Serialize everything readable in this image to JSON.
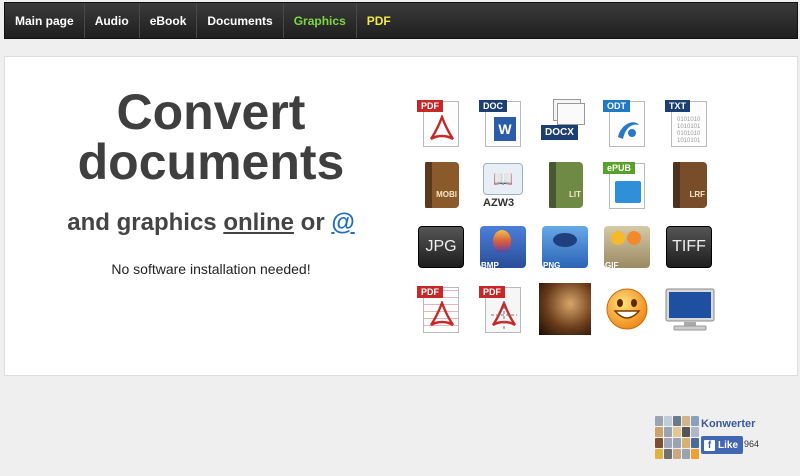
{
  "nav": {
    "items": [
      {
        "label": "Main page"
      },
      {
        "label": "Audio"
      },
      {
        "label": "eBook"
      },
      {
        "label": "Documents"
      },
      {
        "label": "Graphics"
      },
      {
        "label": "PDF"
      }
    ]
  },
  "hero": {
    "title_line1": "Convert",
    "title_line2": "documents",
    "subtitle_part1": "and graphics ",
    "subtitle_link": "online",
    "subtitle_part2": " or ",
    "subtitle_at": "@",
    "note": "No software installation needed!"
  },
  "formats": [
    {
      "icon": "pdf-icon",
      "label": "PDF"
    },
    {
      "icon": "doc-icon",
      "label": "DOC"
    },
    {
      "icon": "docx-icon",
      "label": "DOCX"
    },
    {
      "icon": "odt-icon",
      "label": "ODT"
    },
    {
      "icon": "txt-icon",
      "label": "TXT"
    },
    {
      "icon": "mobi-icon",
      "label": "MOBI"
    },
    {
      "icon": "azw3-icon",
      "label": "AZW3"
    },
    {
      "icon": "lit-icon",
      "label": "LIT"
    },
    {
      "icon": "epub-icon",
      "label": "ePUB"
    },
    {
      "icon": "lrf-icon",
      "label": "LRF"
    },
    {
      "icon": "jpg-icon",
      "label": "JPG"
    },
    {
      "icon": "bmp-icon",
      "label": "BMP"
    },
    {
      "icon": "png-icon",
      "label": "PNG"
    },
    {
      "icon": "gif-icon",
      "label": "GIF"
    },
    {
      "icon": "tiff-icon",
      "label": "TIFF"
    },
    {
      "icon": "pdf-vector-icon",
      "label": "PDF"
    },
    {
      "icon": "pdf-puzzle-icon",
      "label": "PDF"
    },
    {
      "icon": "photo-icon",
      "label": ""
    },
    {
      "icon": "smiley-icon",
      "label": ""
    },
    {
      "icon": "monitor-icon",
      "label": ""
    }
  ],
  "facebook": {
    "page_name": "Konwerter",
    "like_label": "Like",
    "like_count": "964"
  },
  "colors": {
    "nav_bg": "#2b2b2b",
    "nav_graphics": "#7bd93f",
    "nav_pdf": "#f2e84a",
    "title": "#3f3f3f",
    "at_link": "#1f6fbf",
    "fb_blue": "#4267b2"
  }
}
